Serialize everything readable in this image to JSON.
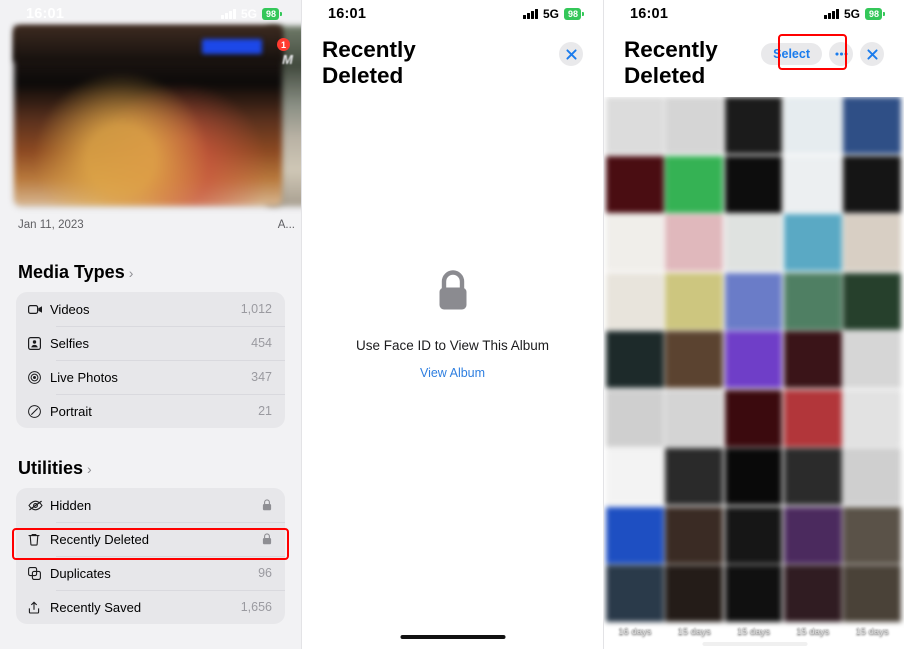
{
  "panels": {
    "left": {
      "status": {
        "time": "16:01",
        "network": "5G",
        "battery": "98"
      },
      "photo_date": "Jan 11, 2023",
      "photo_date_side": "A...",
      "badge_count": "1",
      "badge_letter": "M",
      "sections": [
        {
          "title": "Media Types",
          "chevron": "›",
          "rows": [
            {
              "icon": "video-camera-icon",
              "label": "Videos",
              "count": "1,012"
            },
            {
              "icon": "selfie-icon",
              "label": "Selfies",
              "count": "454"
            },
            {
              "icon": "live-photo-icon",
              "label": "Live Photos",
              "count": "347"
            },
            {
              "icon": "portrait-icon",
              "label": "Portrait",
              "count": "21"
            }
          ]
        },
        {
          "title": "Utilities",
          "chevron": "›",
          "rows": [
            {
              "icon": "eye-slash-icon",
              "label": "Hidden",
              "count": "",
              "locked": true
            },
            {
              "icon": "trash-icon",
              "label": "Recently Deleted",
              "count": "",
              "locked": true,
              "highlighted": true
            },
            {
              "icon": "duplicates-icon",
              "label": "Duplicates",
              "count": "96"
            },
            {
              "icon": "recently-saved-icon",
              "label": "Recently Saved",
              "count": "1,656"
            }
          ]
        }
      ]
    },
    "middle": {
      "status": {
        "time": "16:01",
        "network": "5G",
        "battery": "98"
      },
      "title": "Recently Deleted",
      "close_label": "✕",
      "locked_message": "Use Face ID to View This Album",
      "view_album_label": "View Album"
    },
    "right": {
      "status": {
        "time": "16:01",
        "network": "5G",
        "battery": "98"
      },
      "title": "Recently Deleted",
      "select_label": "Select",
      "more_label": "•••",
      "close_label": "✕",
      "day_labels": [
        "16 days",
        "15 days",
        "15 days",
        "15 days",
        "15 days"
      ],
      "grid_colors": [
        [
          "#dcdcdc",
          "#d5d5d5",
          "#1b1b1b",
          "#e6ecef",
          "#2f4f86"
        ],
        [
          "#4a0d12",
          "#35b254",
          "#0d0d0d",
          "#eceff1",
          "#151515"
        ],
        [
          "#f0eeea",
          "#e0b8bc",
          "#dfe2e0",
          "#5aa9c4",
          "#d8cfc4"
        ],
        [
          "#e8e4dc",
          "#cdc67f",
          "#6a7cc8",
          "#4f7f63",
          "#26402c"
        ],
        [
          "#1d2a2a",
          "#5b4330",
          "#6f3ec8",
          "#3a1418",
          "#d6d6d6"
        ],
        [
          "#cfcfcf",
          "#d4d4d4",
          "#3b0a0e",
          "#b2363a",
          "#e2e2e2"
        ],
        [
          "#f3f3f3",
          "#2a2a2a",
          "#090909",
          "#2b2b2b",
          "#cfcfcf"
        ],
        [
          "#1e4fc2",
          "#3a2b24",
          "#161616",
          "#4b2a5e",
          "#5a5248"
        ],
        [
          "#2a3a4a",
          "#241c18",
          "#101010",
          "#301c22",
          "#4a4238"
        ]
      ]
    }
  },
  "highlights": {
    "color": "#ff0000"
  }
}
